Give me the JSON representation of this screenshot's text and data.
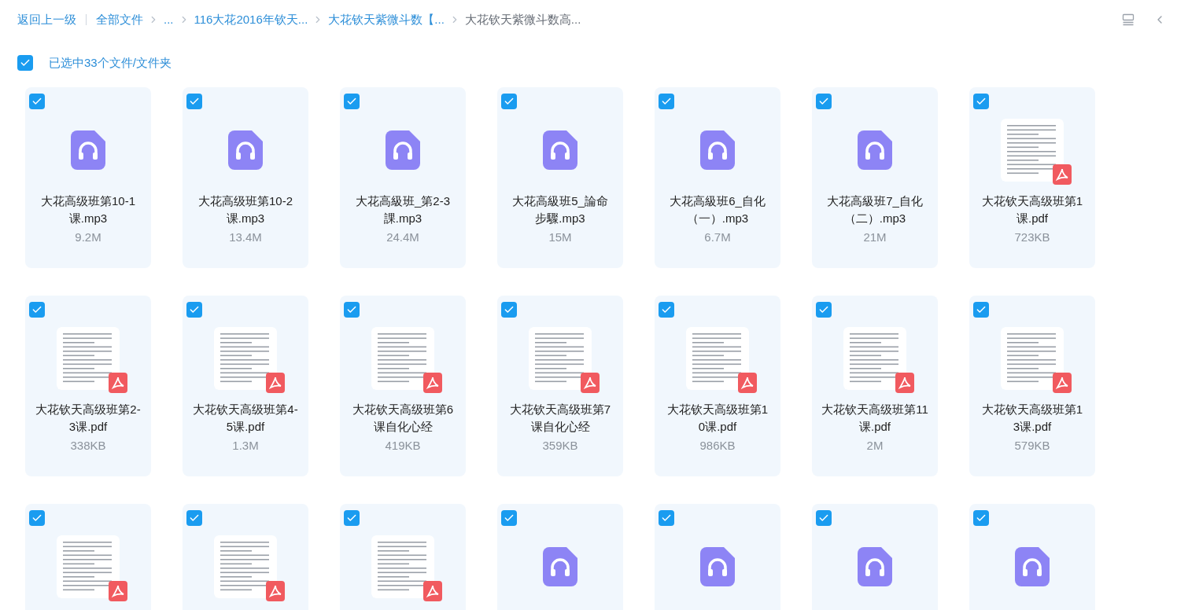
{
  "toolbar": {
    "back_link": "返回上一级",
    "breadcrumbs": [
      {
        "label": "全部文件",
        "current": false
      },
      {
        "label": "...",
        "current": false
      },
      {
        "label": "116大花2016年钦天...",
        "current": false
      },
      {
        "label": "大花钦天紫微斗数【...",
        "current": false
      },
      {
        "label": "大花钦天紫微斗数高...",
        "current": true
      }
    ]
  },
  "selection": {
    "checked": true,
    "label": "已选中33个文件/文件夹"
  },
  "files": [
    {
      "kind": "audio",
      "selected": true,
      "name": "大花高级班第10-1课.mp3",
      "size": "9.2M"
    },
    {
      "kind": "audio",
      "selected": true,
      "name": "大花高级班第10-2课.mp3",
      "size": "13.4M"
    },
    {
      "kind": "audio",
      "selected": true,
      "name": "大花高級班_第2-3課.mp3",
      "size": "24.4M"
    },
    {
      "kind": "audio",
      "selected": true,
      "name": "大花高級班5_論命步驟.mp3",
      "size": "15M"
    },
    {
      "kind": "audio",
      "selected": true,
      "name": "大花高級班6_自化（一）.mp3",
      "size": "6.7M"
    },
    {
      "kind": "audio",
      "selected": true,
      "name": "大花高級班7_自化（二）.mp3",
      "size": "21M"
    },
    {
      "kind": "pdf",
      "selected": true,
      "name": "大花钦天高级班第1课.pdf",
      "size": "723KB"
    },
    {
      "kind": "pdf",
      "selected": true,
      "name": "大花钦天高级班第2-3课.pdf",
      "size": "338KB"
    },
    {
      "kind": "pdf",
      "selected": true,
      "name": "大花钦天高级班第4-5课.pdf",
      "size": "1.3M"
    },
    {
      "kind": "pdf",
      "selected": true,
      "name": "大花钦天高级班第6课自化心经",
      "size": "419KB"
    },
    {
      "kind": "pdf",
      "selected": true,
      "name": "大花钦天高级班第7课自化心经",
      "size": "359KB"
    },
    {
      "kind": "pdf",
      "selected": true,
      "name": "大花钦天高级班第10课.pdf",
      "size": "986KB"
    },
    {
      "kind": "pdf",
      "selected": true,
      "name": "大花钦天高级班第11课.pdf",
      "size": "2M"
    },
    {
      "kind": "pdf",
      "selected": true,
      "name": "大花钦天高级班第13课.pdf",
      "size": "579KB"
    },
    {
      "kind": "pdf",
      "selected": true
    },
    {
      "kind": "pdf",
      "selected": true
    },
    {
      "kind": "pdf",
      "selected": true
    },
    {
      "kind": "audio",
      "selected": true
    },
    {
      "kind": "audio",
      "selected": true
    },
    {
      "kind": "audio",
      "selected": true
    },
    {
      "kind": "audio",
      "selected": true
    }
  ]
}
